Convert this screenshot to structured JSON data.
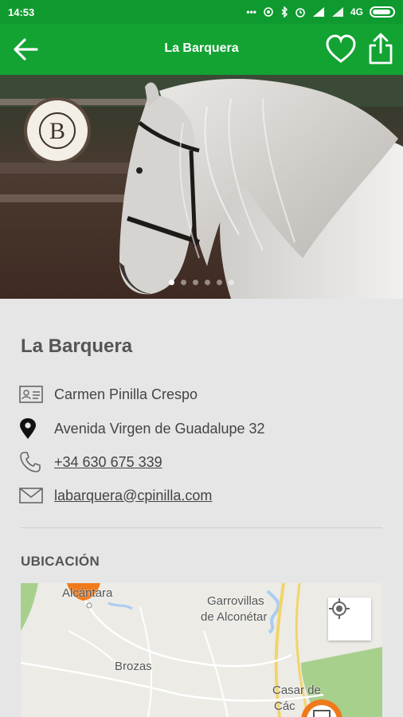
{
  "status_bar": {
    "time": "14:53",
    "network": "4G"
  },
  "app_bar": {
    "title": "La Barquera",
    "back_icon": "arrow-left-icon",
    "favorite_icon": "heart-outline-icon",
    "share_icon": "share-icon"
  },
  "hero": {
    "image": "white horse with long mane",
    "logo_letter": "B",
    "carousel": {
      "total": 6,
      "active_index": 0
    }
  },
  "details": {
    "name": "La Barquera",
    "contact_name": "Carmen Pinilla Crespo",
    "address": "Avenida Virgen de Guadalupe 32",
    "phone": "+34 630 675 339",
    "email": "labarquera@cpinilla.com"
  },
  "location": {
    "section_title": "UBICACIÓN",
    "map_labels": {
      "alcantara": "Alcántara",
      "garrovillas_line1": "Garrovillas",
      "garrovillas_line2": "de Alconétar",
      "brozas": "Brozas",
      "casar_line1": "Casar de",
      "casar_line2": "Các"
    },
    "my_location_icon": "crosshair-icon"
  },
  "colors": {
    "primary": "#12a333",
    "status_bar": "#0f9a30",
    "background": "#e6e6e6",
    "marker": "#f07a1a"
  }
}
